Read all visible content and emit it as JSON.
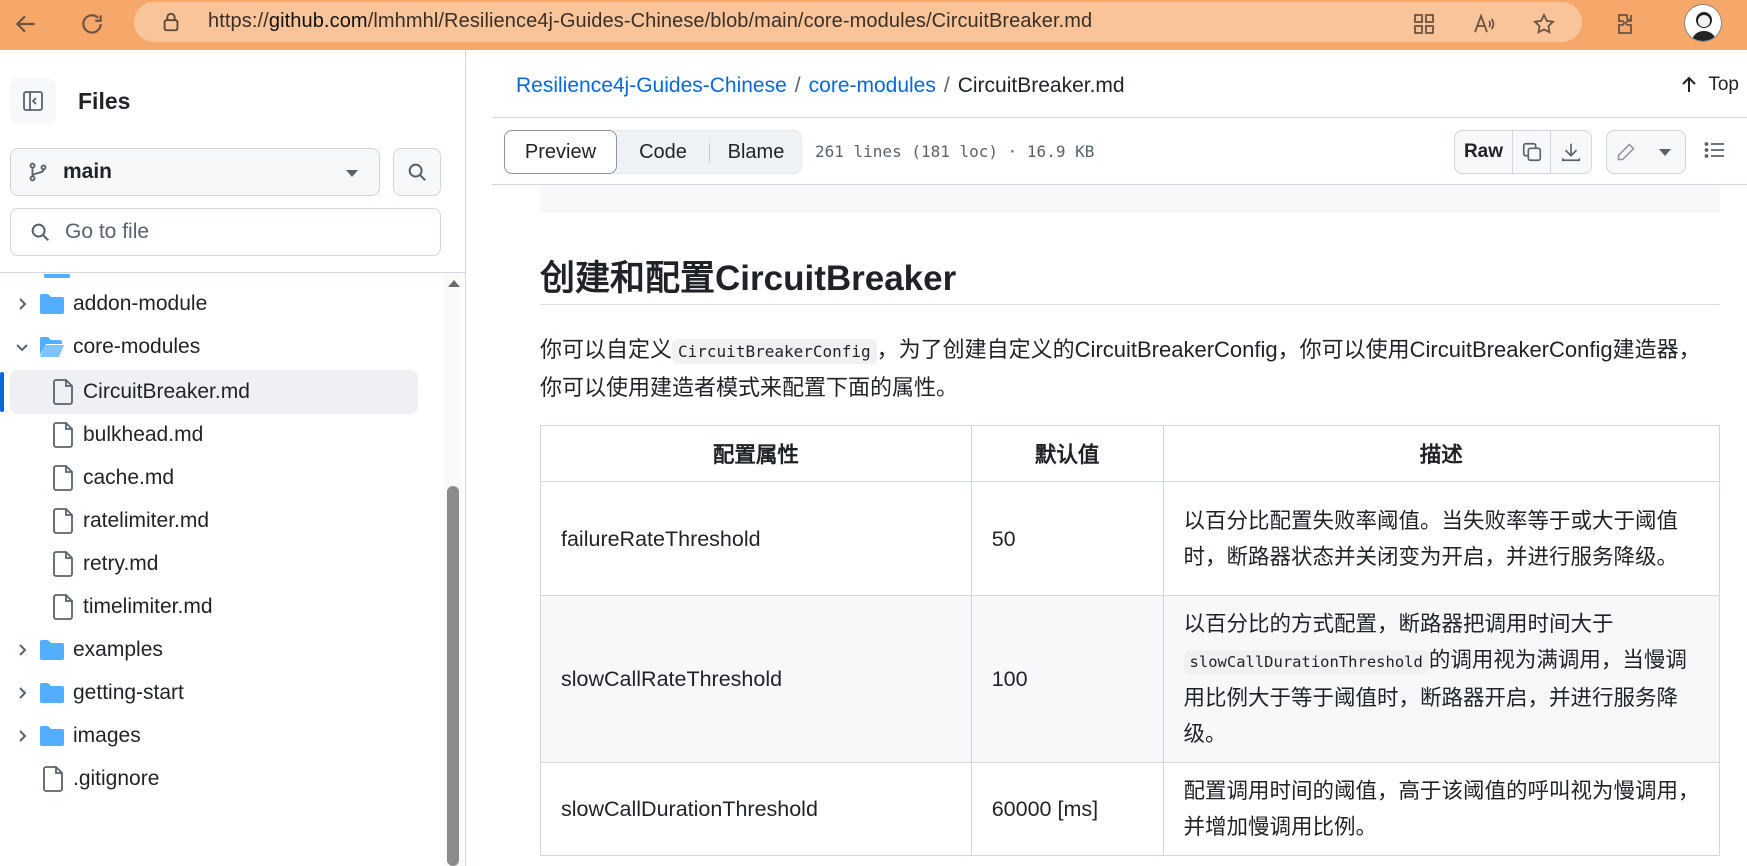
{
  "browser": {
    "url_scheme": "https://",
    "url_host": "github.com",
    "url_path": "/lmhmhl/Resilience4j-Guides-Chinese/blob/main/core-modules/CircuitBreaker.md"
  },
  "sidebar": {
    "title": "Files",
    "branch": "main",
    "goto_placeholder": "Go to file",
    "tree": [
      {
        "label": "addon-module",
        "type": "folder",
        "expanded": false
      },
      {
        "label": "core-modules",
        "type": "folder",
        "expanded": true
      },
      {
        "label": "CircuitBreaker.md",
        "type": "file",
        "selected": true
      },
      {
        "label": "bulkhead.md",
        "type": "file"
      },
      {
        "label": "cache.md",
        "type": "file"
      },
      {
        "label": "ratelimiter.md",
        "type": "file"
      },
      {
        "label": "retry.md",
        "type": "file"
      },
      {
        "label": "timelimiter.md",
        "type": "file"
      },
      {
        "label": "examples",
        "type": "folder",
        "expanded": false
      },
      {
        "label": "getting-start",
        "type": "folder",
        "expanded": false
      },
      {
        "label": "images",
        "type": "folder",
        "expanded": false
      },
      {
        "label": ".gitignore",
        "type": "file"
      }
    ]
  },
  "breadcrumb": {
    "repo": "Resilience4j-Guides-Chinese",
    "folder": "core-modules",
    "file": "CircuitBreaker.md",
    "sep": "/"
  },
  "top_link": "Top",
  "toolbar": {
    "tabs": [
      "Preview",
      "Code",
      "Blame"
    ],
    "file_info": "261 lines (181 loc) · 16.9 KB",
    "raw_label": "Raw"
  },
  "content": {
    "heading": "创建和配置CircuitBreaker",
    "para_prefix": "你可以自定义",
    "para_code": "CircuitBreakerConfig",
    "para_suffix": "，为了创建自定义的CircuitBreakerConfig，你可以使用CircuitBreakerConfig建造器，你可以使用建造者模式来配置下面的属性。",
    "table": {
      "headers": [
        "配置属性",
        "默认值",
        "描述"
      ],
      "rows": [
        {
          "name": "failureRateThreshold",
          "default": "50",
          "desc": "以百分比配置失败率阈值。当失败率等于或大于阈值时，断路器状态并关闭变为开启，并进行服务降级。"
        },
        {
          "name": "slowCallRateThreshold",
          "default": "100",
          "desc_prefix": "以百分比的方式配置，断路器把调用时间大于",
          "desc_code": "slowCallDurationThreshold",
          "desc_suffix": "的调用视为满调用，当慢调用比例大于等于阈值时，断路器开启，并进行服务降级。"
        },
        {
          "name": "slowCallDurationThreshold",
          "default": "60000 [ms]",
          "desc": "配置调用时间的阈值，高于该阈值的呼叫视为慢调用，并增加慢调用比例。"
        }
      ]
    }
  },
  "colors": {
    "browser_bar": "#f6a86b",
    "link": "#0969da",
    "folder": "#54aeff",
    "selected_bar": "#0969da"
  }
}
